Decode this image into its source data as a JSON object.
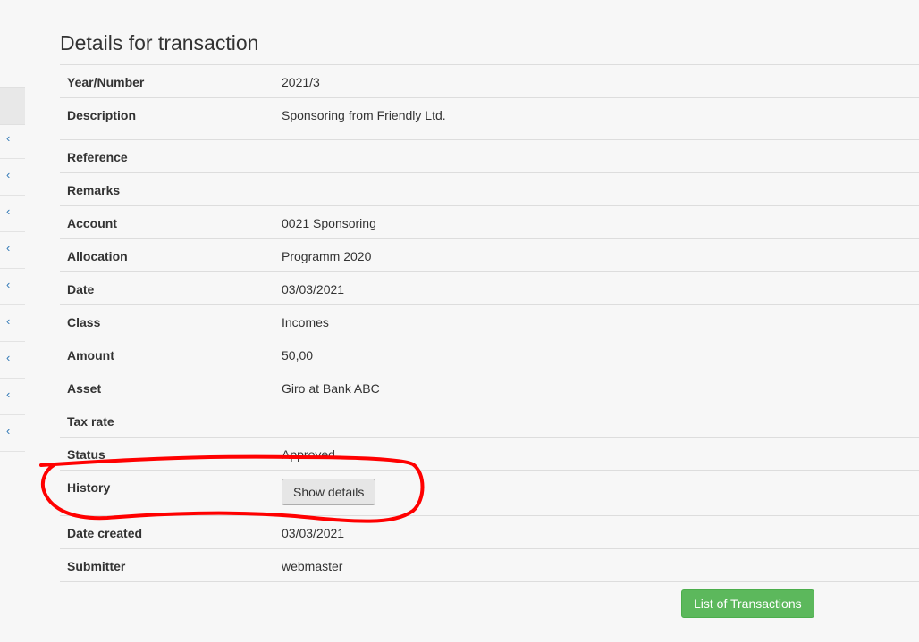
{
  "page": {
    "title": "Details for transaction"
  },
  "details": [
    {
      "label": "Year/Number",
      "value": "2021/3"
    },
    {
      "label": "Description",
      "value": "Sponsoring from Friendly Ltd."
    },
    {
      "label": "Reference",
      "value": ""
    },
    {
      "label": "Remarks",
      "value": ""
    },
    {
      "label": "Account",
      "value": "0021 Sponsoring"
    },
    {
      "label": "Allocation",
      "value": "Programm 2020"
    },
    {
      "label": "Date",
      "value": "03/03/2021"
    },
    {
      "label": "Class",
      "value": "Incomes"
    },
    {
      "label": "Amount",
      "value": "50,00"
    },
    {
      "label": "Asset",
      "value": "Giro at Bank ABC"
    },
    {
      "label": "Tax rate",
      "value": ""
    },
    {
      "label": "Status",
      "value": "Approved"
    },
    {
      "label": "History",
      "button": "Show details"
    },
    {
      "label": "Date created",
      "value": "03/03/2021"
    },
    {
      "label": "Submitter",
      "value": "webmaster"
    }
  ],
  "actions": {
    "list_button": "List of Transactions"
  },
  "sidebar": {
    "chevron_icon": "chevron-left-icon",
    "item_count": 9
  },
  "colors": {
    "accent_link": "#337ab7",
    "success": "#5cb85c",
    "annotation": "#ff0000"
  }
}
